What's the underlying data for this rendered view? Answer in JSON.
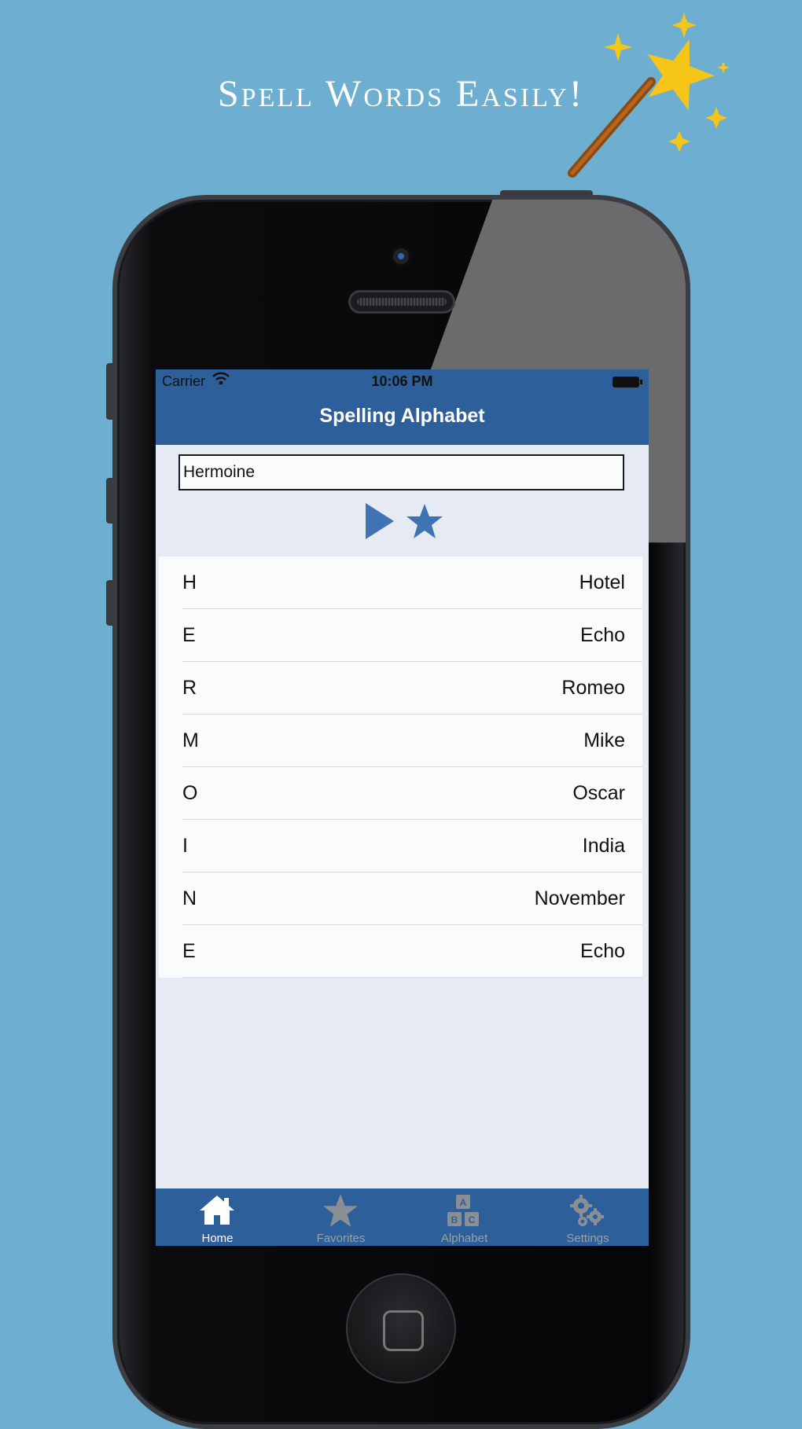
{
  "promo": {
    "headline": "Spell Words Easily!"
  },
  "status_bar": {
    "carrier": "Carrier",
    "time": "10:06 PM"
  },
  "nav": {
    "title": "Spelling Alphabet"
  },
  "input": {
    "value": "Hermoine"
  },
  "controls": {
    "play_icon": "play-icon",
    "favorite_icon": "star-icon"
  },
  "spelling": [
    {
      "letter": "H",
      "word": "Hotel"
    },
    {
      "letter": "E",
      "word": "Echo"
    },
    {
      "letter": "R",
      "word": "Romeo"
    },
    {
      "letter": "M",
      "word": "Mike"
    },
    {
      "letter": "O",
      "word": "Oscar"
    },
    {
      "letter": "I",
      "word": "India"
    },
    {
      "letter": "N",
      "word": "November"
    },
    {
      "letter": "E",
      "word": "Echo"
    }
  ],
  "tabs": [
    {
      "label": "Home",
      "icon": "home-icon",
      "active": true
    },
    {
      "label": "Favorites",
      "icon": "star-icon",
      "active": false
    },
    {
      "label": "Alphabet",
      "icon": "abc-blocks-icon",
      "active": false
    },
    {
      "label": "Settings",
      "icon": "gears-icon",
      "active": false
    }
  ],
  "colors": {
    "background": "#6eaed0",
    "brand_blue": "#2d5f9b",
    "accent_blue": "#3f73b3",
    "star_yellow": "#f5c518"
  }
}
